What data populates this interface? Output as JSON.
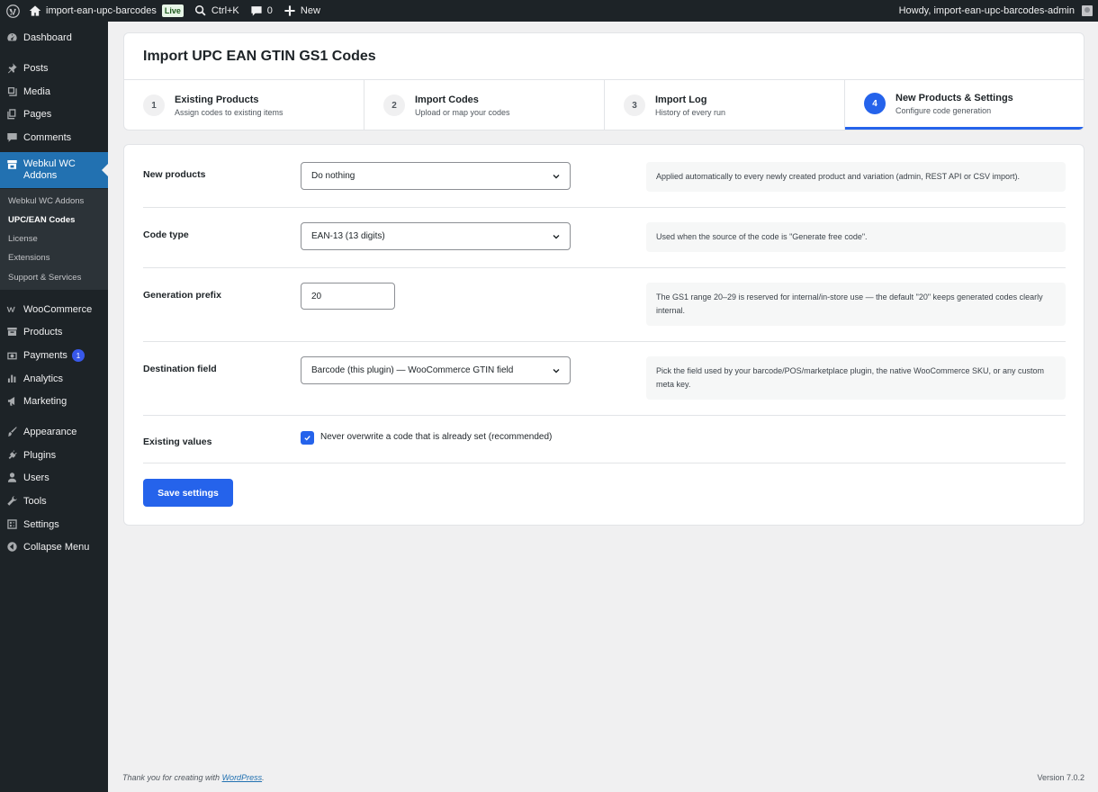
{
  "admin_bar": {
    "site_name": "import-ean-upc-barcodes",
    "live_badge": "Live",
    "search_shortcut": "Ctrl+K",
    "comments_count": "0",
    "new_label": "New",
    "greeting": "Howdy, import-ean-upc-barcodes-admin"
  },
  "sidebar": {
    "items": [
      {
        "label": "Dashboard",
        "icon": "dashboard-icon"
      },
      {
        "label": "Posts",
        "icon": "pin-icon"
      },
      {
        "label": "Media",
        "icon": "media-icon"
      },
      {
        "label": "Pages",
        "icon": "pages-icon"
      },
      {
        "label": "Comments",
        "icon": "comment-icon"
      },
      {
        "label": "Webkul WC Addons",
        "icon": "store-icon"
      },
      {
        "label": "WooCommerce",
        "icon": "woocommerce-icon"
      },
      {
        "label": "Products",
        "icon": "archive-icon"
      },
      {
        "label": "Payments",
        "icon": "money-icon",
        "badge": "1"
      },
      {
        "label": "Analytics",
        "icon": "chart-icon"
      },
      {
        "label": "Marketing",
        "icon": "megaphone-icon"
      },
      {
        "label": "Appearance",
        "icon": "brush-icon"
      },
      {
        "label": "Plugins",
        "icon": "plugin-icon"
      },
      {
        "label": "Users",
        "icon": "user-icon"
      },
      {
        "label": "Tools",
        "icon": "wrench-icon"
      },
      {
        "label": "Settings",
        "icon": "settings-icon"
      },
      {
        "label": "Collapse Menu",
        "icon": "collapse-icon"
      }
    ],
    "submenu": [
      "Webkul WC Addons",
      "UPC/EAN Codes",
      "License",
      "Extensions",
      "Support & Services"
    ]
  },
  "page": {
    "title": "Import UPC EAN GTIN GS1 Codes",
    "tabs": [
      {
        "num": "1",
        "label": "Existing Products",
        "sub": "Assign codes to existing items"
      },
      {
        "num": "2",
        "label": "Import Codes",
        "sub": "Upload or map your codes"
      },
      {
        "num": "3",
        "label": "Import Log",
        "sub": "History of every run"
      },
      {
        "num": "4",
        "label": "New Products & Settings",
        "sub": "Configure code generation"
      }
    ]
  },
  "settings": {
    "new_products": {
      "label": "New products",
      "value": "Do nothing",
      "help": "Applied automatically to every newly created product and variation (admin, REST API or CSV import)."
    },
    "code_type": {
      "label": "Code type",
      "value": "EAN-13 (13 digits)",
      "help": "Used when the source of the code is \"Generate free code\"."
    },
    "generation_prefix": {
      "label": "Generation prefix",
      "value": "20",
      "help": "The GS1 range 20–29 is reserved for internal/in-store use — the default \"20\" keeps generated codes clearly internal."
    },
    "destination_field": {
      "label": "Destination field",
      "value": "Barcode (this plugin) — WooCommerce GTIN field",
      "help": "Pick the field used by your barcode/POS/marketplace plugin, the native WooCommerce SKU, or any custom meta key."
    },
    "existing_values": {
      "label": "Existing values",
      "checkbox_label": "Never overwrite a code that is already set (recommended)",
      "checked": true
    },
    "save_label": "Save settings"
  },
  "footer": {
    "thanks_prefix": "Thank you for creating with ",
    "thanks_link": "WordPress",
    "thanks_suffix": ".",
    "version": "Version 7.0.2"
  },
  "colors": {
    "accent": "#2563eb",
    "admin_dark": "#1d2327",
    "menu_current": "#2271b1"
  }
}
